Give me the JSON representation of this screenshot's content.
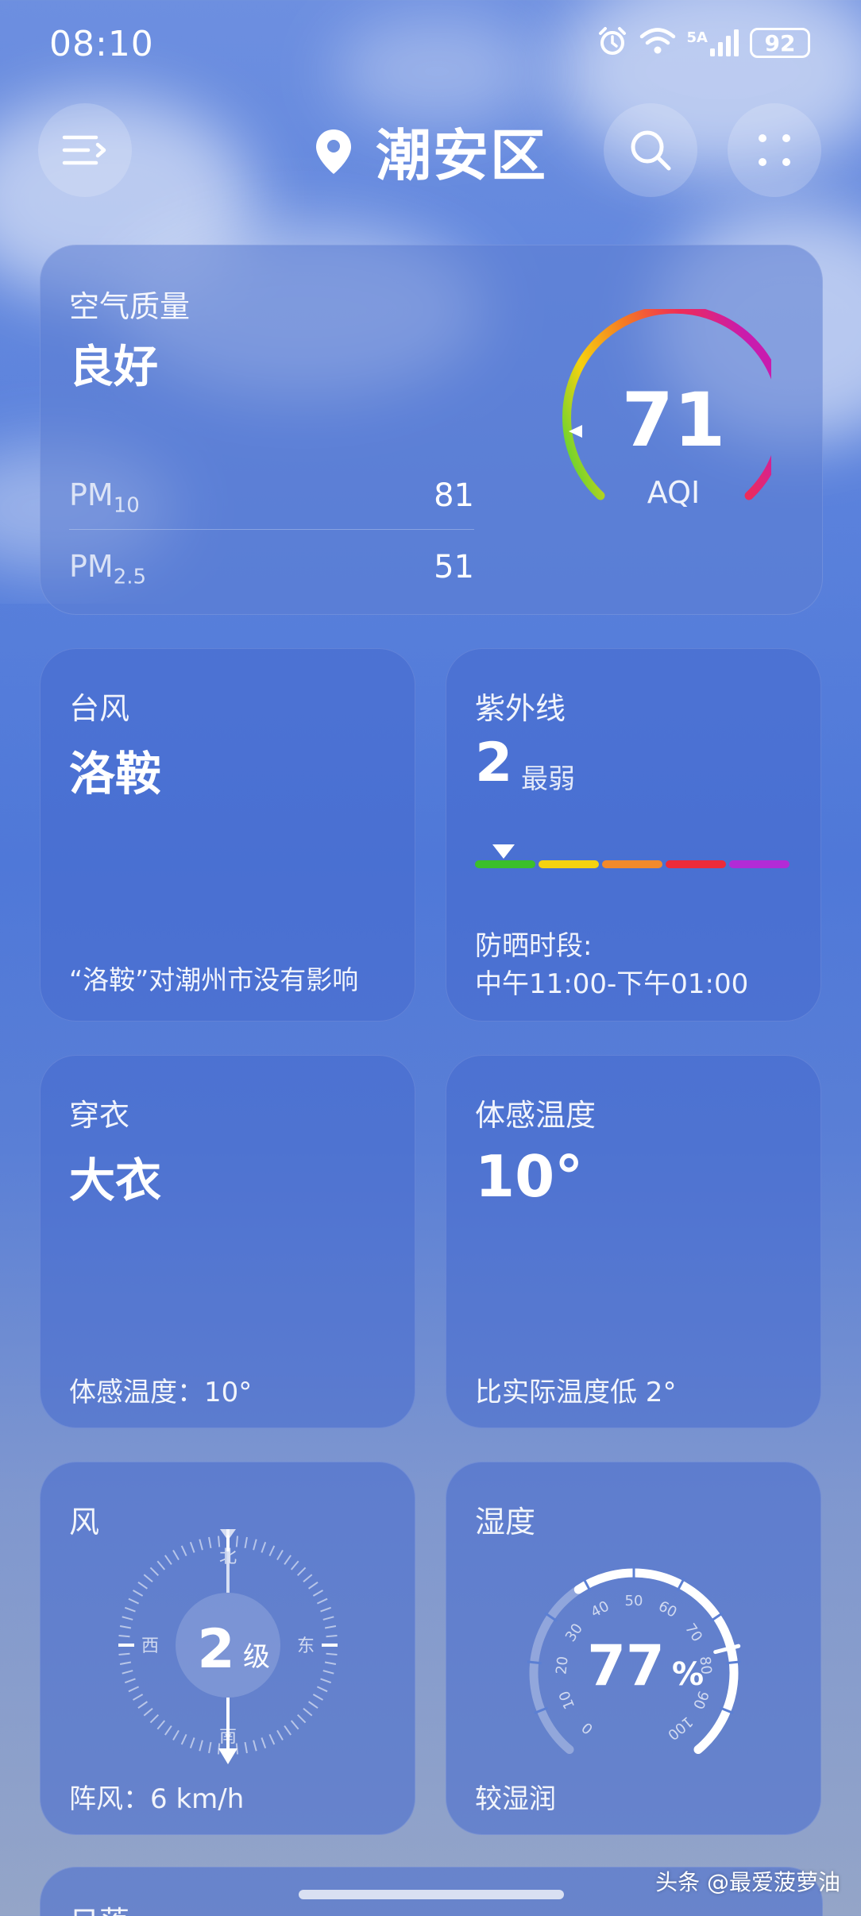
{
  "status_bar": {
    "time": "08:10",
    "network": "5A",
    "battery": "92"
  },
  "header": {
    "city": "潮安区"
  },
  "air_quality": {
    "title": "空气质量",
    "level": "良好",
    "pm10_label": "PM",
    "pm10_sub": "10",
    "pm10_value": "81",
    "pm25_label": "PM",
    "pm25_sub": "2.5",
    "pm25_value": "51",
    "aqi_value": "71",
    "aqi_label": "AQI",
    "aqi_fraction": 0.14
  },
  "typhoon": {
    "title": "台风",
    "name": "洛鞍",
    "note": "“洛鞍”对潮州市没有影响"
  },
  "uv": {
    "title": "紫外线",
    "index": "2",
    "level": "最弱",
    "sun_label": "防晒时段:",
    "sun_period": "中午11:00-下午01:00",
    "colors": [
      "#3bbf2a",
      "#f5d20f",
      "#f28a2b",
      "#ec2b3a",
      "#b22bd6"
    ]
  },
  "clothing": {
    "title": "穿衣",
    "value": "大衣",
    "foot": "体感温度：10°"
  },
  "feels_like": {
    "title": "体感温度",
    "value": "10°",
    "foot": "比实际温度低 2°"
  },
  "wind": {
    "title": "风",
    "level": "2",
    "level_unit": "级",
    "north": "北",
    "south": "南",
    "east": "东",
    "west": "西",
    "gust": "阵风：6 km/h"
  },
  "humidity": {
    "title": "湿度",
    "value": "77",
    "unit": "%",
    "desc": "较湿润",
    "ticks": [
      "0",
      "10",
      "20",
      "30",
      "40",
      "50",
      "60",
      "70",
      "80",
      "90",
      "100"
    ],
    "fraction": 0.77
  },
  "next_card": {
    "title": "日落"
  },
  "watermark": "头条 @最爱菠萝油"
}
